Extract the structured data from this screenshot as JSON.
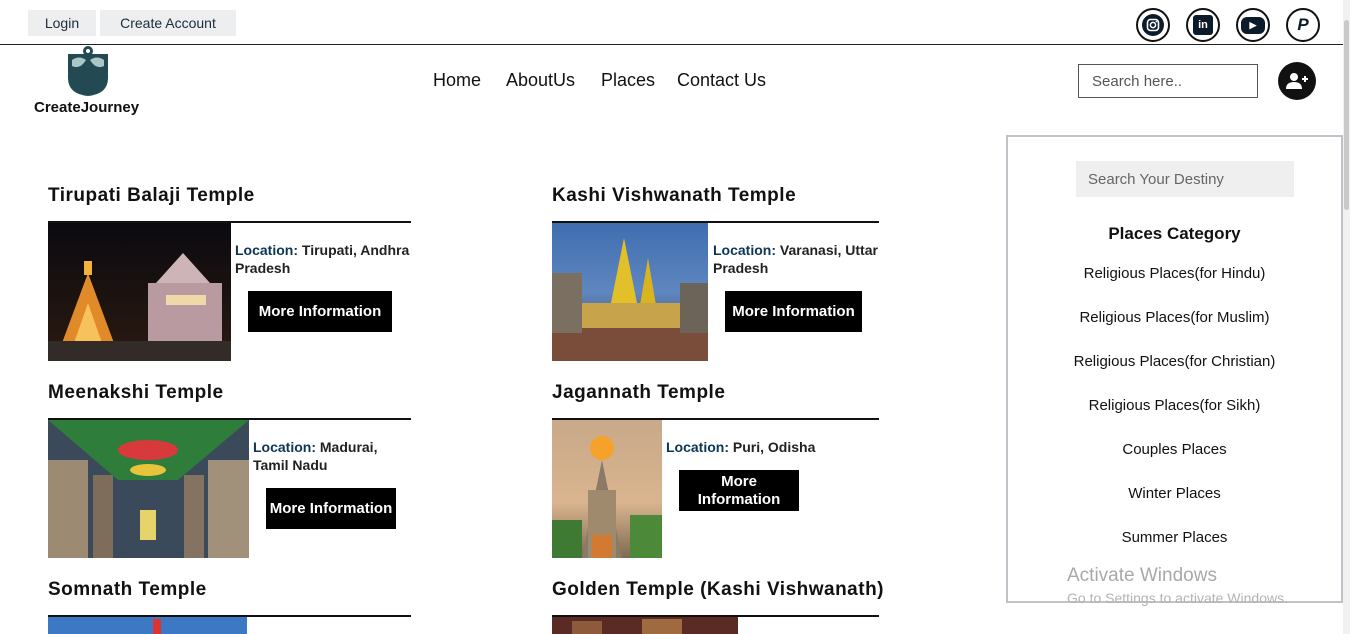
{
  "topbar": {
    "login_label": "Login",
    "create_account_label": "Create Account",
    "social": [
      {
        "icon": "instagram-icon",
        "glyph": "◎"
      },
      {
        "icon": "linkedin-icon",
        "glyph": "in"
      },
      {
        "icon": "youtube-icon",
        "glyph": "▶"
      },
      {
        "icon": "paypal-icon",
        "glyph": "P"
      }
    ]
  },
  "header": {
    "brand": "CreateJourney",
    "nav": [
      "Home",
      "AboutUs",
      "Places",
      "Contact Us"
    ],
    "search_placeholder": "Search here.."
  },
  "cards": [
    {
      "title": "Tirupati Balaji Temple",
      "location_label": "Location:",
      "location": "Tirupati, Andhra Pradesh",
      "button": "More Information"
    },
    {
      "title": "Kashi Vishwanath Temple",
      "location_label": "Location:",
      "location": "Varanasi, Uttar Pradesh",
      "button": "More Information"
    },
    {
      "title": "Meenakshi Temple",
      "location_label": "Location:",
      "location": "Madurai, Tamil Nadu",
      "button": "More Information"
    },
    {
      "title": "Jagannath Temple",
      "location_label": "Location:",
      "location": "Puri, Odisha",
      "button": "More Information"
    },
    {
      "title": "Somnath Temple"
    },
    {
      "title": "Golden Temple (Kashi Vishwanath)"
    }
  ],
  "sidebar": {
    "search_placeholder": "Search Your Destiny",
    "category_title": "Places Category",
    "categories": [
      "Religious Places(for Hindu)",
      "Religious Places(for Muslim)",
      "Religious Places(for Christian)",
      "Religious Places(for Sikh)",
      "Couples Places",
      "Winter Places",
      "Summer Places"
    ]
  },
  "watermark": {
    "line1": "Activate Windows",
    "line2": "Go to Settings to activate Windows."
  },
  "colors": {
    "location_label": "#0d3556",
    "button_bg": "#000000",
    "topbtn_bg": "#eceef0",
    "sidebar_border": "#bfc3c7"
  }
}
